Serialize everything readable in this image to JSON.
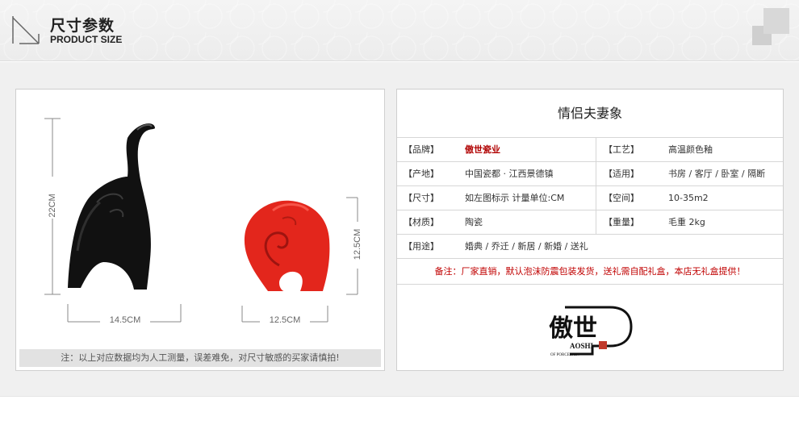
{
  "header": {
    "title_cn": "尺寸参数",
    "title_en": "PRODUCT SIZE"
  },
  "photo": {
    "dims": {
      "height_left": "22CM",
      "width_left": "14.5CM",
      "width_right": "12.5CM",
      "height_right": "12.5CM"
    },
    "note": "注：以上对应数据均为人工测量，误差难免，对尺寸敏感的买家请慎拍!"
  },
  "spec": {
    "title": "情侣夫妻象",
    "rows": [
      {
        "l1": "【品牌】",
        "v1": "傲世瓷业",
        "l2": "【工艺】",
        "v2": "高温颜色釉"
      },
      {
        "l1": "【产地】",
        "v1": "中国瓷都 · 江西景德镇",
        "l2": "【适用】",
        "v2": "书房 / 客厅 / 卧室 / 隔断"
      },
      {
        "l1": "【尺寸】",
        "v1": "如左图标示 计量单位:CM",
        "l2": "【空间】",
        "v2": "10-35m2"
      },
      {
        "l1": "【材质】",
        "v1": "陶瓷",
        "l2": "【重量】",
        "v2": "毛重 2kg"
      }
    ],
    "usage_label": "【用途】",
    "usage_value": "婚典 / 乔迁 / 新居  /  新婚 / 送礼",
    "remark": "备注：厂家直销，默认泡沫防震包装发货，送礼需自配礼盒，本店无礼盒提供！",
    "logo": {
      "mark": "傲世",
      "name": "AOSHI",
      "sub": "OF PORCELAIN"
    }
  },
  "colors": {
    "brand_red": "#b00000",
    "remark_red": "#c00000",
    "elephant_black": "#111111",
    "elephant_red": "#e3261c"
  }
}
